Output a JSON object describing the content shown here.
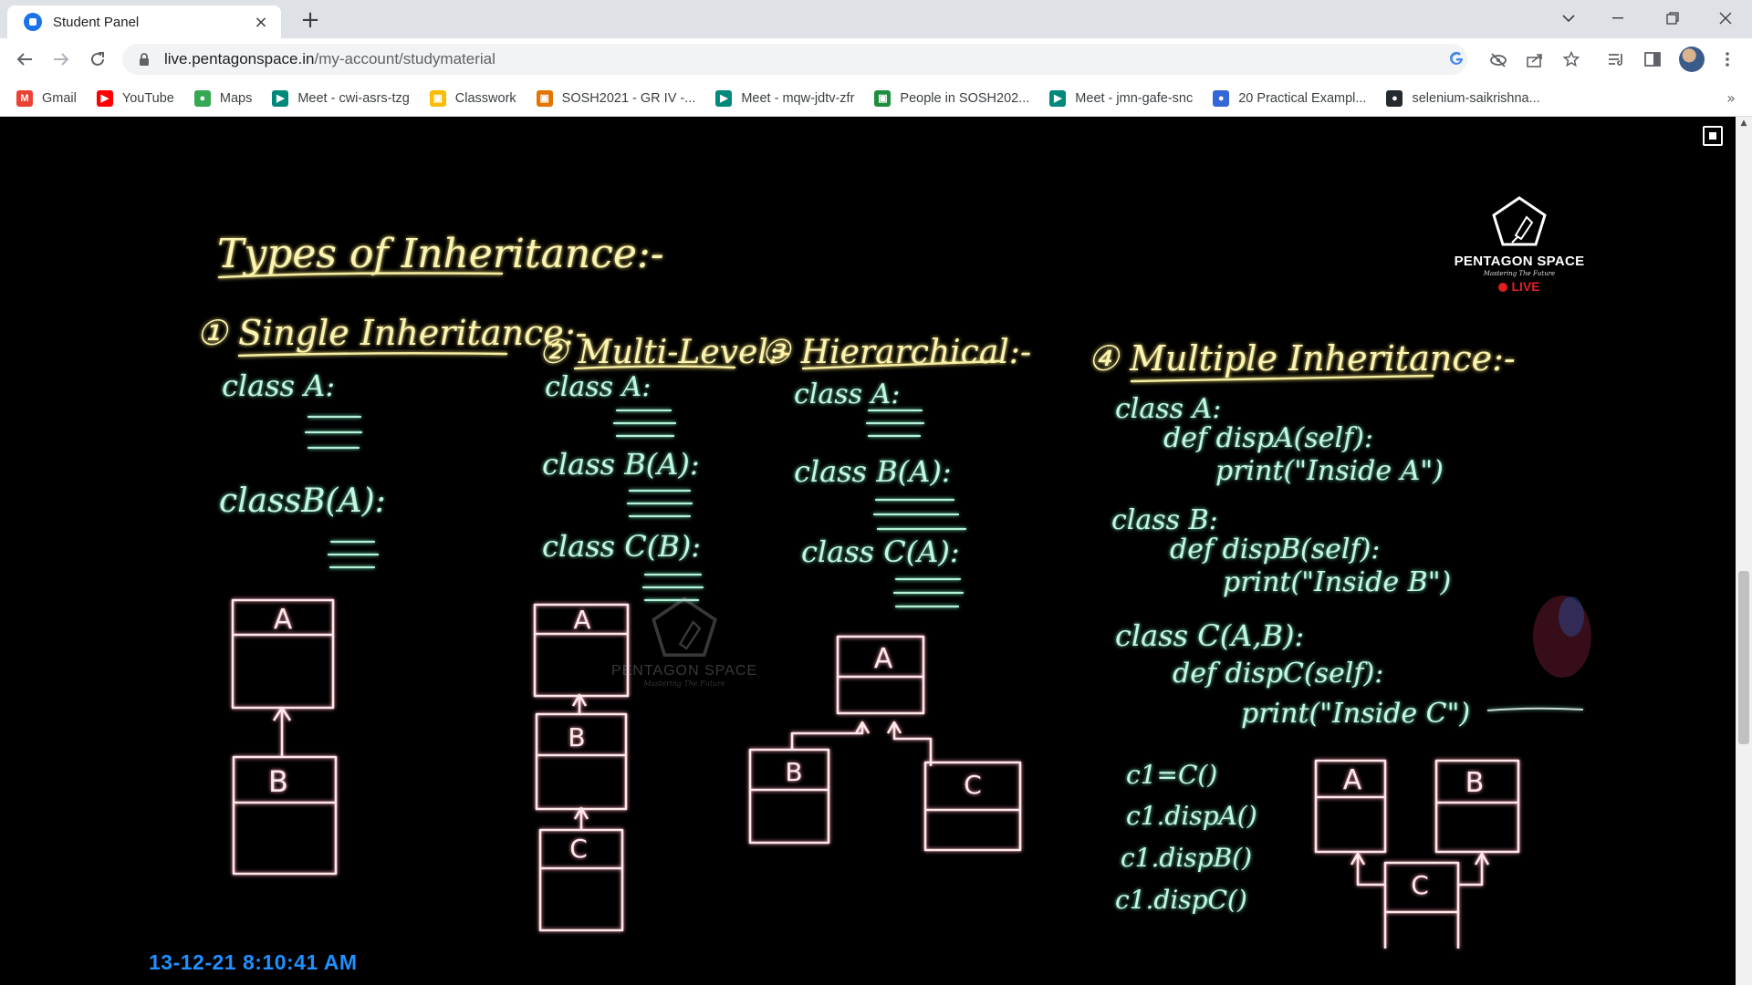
{
  "browser": {
    "tab": {
      "title": "Student Panel",
      "close_icon": "×"
    },
    "new_tab_icon": "+",
    "address": {
      "host": "live.pentagonspace.in",
      "path": "/my-account/studymaterial"
    },
    "bookmarks": [
      {
        "label": "Gmail",
        "icon": "gmail-icon",
        "color": "#ea4335",
        "glyph": "M"
      },
      {
        "label": "YouTube",
        "icon": "youtube-icon",
        "color": "#ff0000",
        "glyph": "▶"
      },
      {
        "label": "Maps",
        "icon": "maps-icon",
        "color": "#34a853",
        "glyph": "●"
      },
      {
        "label": "Meet - cwi-asrs-tzg",
        "icon": "meet-icon",
        "color": "#00897b",
        "glyph": "▶"
      },
      {
        "label": "Classwork",
        "icon": "classroom-icon",
        "color": "#fbbc04",
        "glyph": "▣"
      },
      {
        "label": "SOSH2021 - GR IV -...",
        "icon": "classroom-icon",
        "color": "#e37400",
        "glyph": "▣"
      },
      {
        "label": "Meet - mqw-jdtv-zfr",
        "icon": "meet-icon",
        "color": "#00897b",
        "glyph": "▶"
      },
      {
        "label": "People in SOSH202...",
        "icon": "classroom-icon",
        "color": "#1e8e3e",
        "glyph": "▣"
      },
      {
        "label": "Meet - jmn-gafe-snc",
        "icon": "meet-icon",
        "color": "#00897b",
        "glyph": "▶"
      },
      {
        "label": "20 Practical Exampl...",
        "icon": "site-icon",
        "color": "#3367d6",
        "glyph": "●"
      },
      {
        "label": "selenium-saikrishna...",
        "icon": "github-icon",
        "color": "#24292e",
        "glyph": "●"
      }
    ],
    "bookmarks_overflow": "»"
  },
  "video": {
    "timestamp": "13-12-21 8:10:41 AM",
    "logo": {
      "name": "PENTAGON SPACE",
      "tagline": "Mastering The Future",
      "live": "LIVE"
    },
    "watermark": {
      "name": "PENTAGON SPACE",
      "tagline": "Mastering The Future"
    },
    "board": {
      "title": "Types of Inheritance:-",
      "sections": [
        {
          "heading": "① Single Inheritance:-",
          "code": [
            "class A:",
            "classB(A):"
          ],
          "boxes": [
            "A",
            "B"
          ]
        },
        {
          "heading": "② Multi-Level:-",
          "code": [
            "class A:",
            "class B(A):",
            "class C(B):"
          ],
          "boxes": [
            "A",
            "B",
            "C"
          ]
        },
        {
          "heading": "③ Hierarchical:-",
          "code": [
            "class A:",
            "class B(A):",
            "class C(A):"
          ],
          "boxes": [
            "A",
            "B",
            "C"
          ]
        },
        {
          "heading": "④ Multiple Inheritance:-",
          "code": [
            "class A:",
            "def dispA(self):",
            "print(\"Inside A\")",
            "class B:",
            "def dispB(self):",
            "print(\"Inside B\")",
            "class C(A,B):",
            "def dispC(self):",
            "print(\"Inside C\")"
          ],
          "calls": [
            "c1=C()",
            "c1.dispA()",
            "c1.dispB()",
            "c1.dispC()"
          ],
          "boxes": [
            "A",
            "B",
            "C"
          ]
        }
      ]
    }
  }
}
